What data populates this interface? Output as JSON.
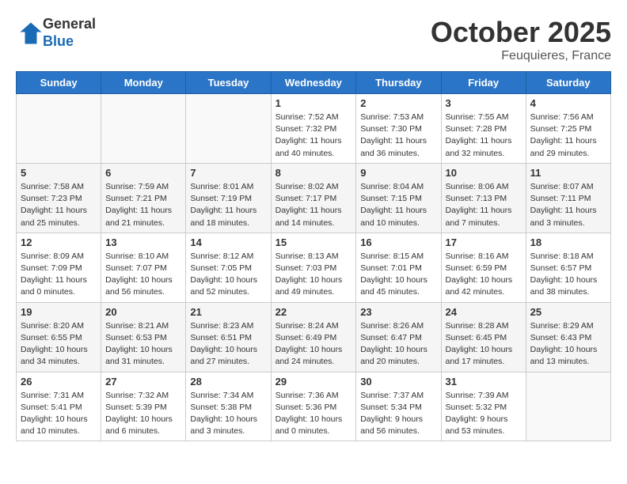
{
  "logo": {
    "line1": "General",
    "line2": "Blue"
  },
  "header": {
    "month": "October 2025",
    "location": "Feuquieres, France"
  },
  "weekdays": [
    "Sunday",
    "Monday",
    "Tuesday",
    "Wednesday",
    "Thursday",
    "Friday",
    "Saturday"
  ],
  "weeks": [
    [
      {
        "day": null,
        "info": null
      },
      {
        "day": null,
        "info": null
      },
      {
        "day": null,
        "info": null
      },
      {
        "day": "1",
        "sunrise": "Sunrise: 7:52 AM",
        "sunset": "Sunset: 7:32 PM",
        "daylight": "Daylight: 11 hours and 40 minutes."
      },
      {
        "day": "2",
        "sunrise": "Sunrise: 7:53 AM",
        "sunset": "Sunset: 7:30 PM",
        "daylight": "Daylight: 11 hours and 36 minutes."
      },
      {
        "day": "3",
        "sunrise": "Sunrise: 7:55 AM",
        "sunset": "Sunset: 7:28 PM",
        "daylight": "Daylight: 11 hours and 32 minutes."
      },
      {
        "day": "4",
        "sunrise": "Sunrise: 7:56 AM",
        "sunset": "Sunset: 7:25 PM",
        "daylight": "Daylight: 11 hours and 29 minutes."
      }
    ],
    [
      {
        "day": "5",
        "sunrise": "Sunrise: 7:58 AM",
        "sunset": "Sunset: 7:23 PM",
        "daylight": "Daylight: 11 hours and 25 minutes."
      },
      {
        "day": "6",
        "sunrise": "Sunrise: 7:59 AM",
        "sunset": "Sunset: 7:21 PM",
        "daylight": "Daylight: 11 hours and 21 minutes."
      },
      {
        "day": "7",
        "sunrise": "Sunrise: 8:01 AM",
        "sunset": "Sunset: 7:19 PM",
        "daylight": "Daylight: 11 hours and 18 minutes."
      },
      {
        "day": "8",
        "sunrise": "Sunrise: 8:02 AM",
        "sunset": "Sunset: 7:17 PM",
        "daylight": "Daylight: 11 hours and 14 minutes."
      },
      {
        "day": "9",
        "sunrise": "Sunrise: 8:04 AM",
        "sunset": "Sunset: 7:15 PM",
        "daylight": "Daylight: 11 hours and 10 minutes."
      },
      {
        "day": "10",
        "sunrise": "Sunrise: 8:06 AM",
        "sunset": "Sunset: 7:13 PM",
        "daylight": "Daylight: 11 hours and 7 minutes."
      },
      {
        "day": "11",
        "sunrise": "Sunrise: 8:07 AM",
        "sunset": "Sunset: 7:11 PM",
        "daylight": "Daylight: 11 hours and 3 minutes."
      }
    ],
    [
      {
        "day": "12",
        "sunrise": "Sunrise: 8:09 AM",
        "sunset": "Sunset: 7:09 PM",
        "daylight": "Daylight: 11 hours and 0 minutes."
      },
      {
        "day": "13",
        "sunrise": "Sunrise: 8:10 AM",
        "sunset": "Sunset: 7:07 PM",
        "daylight": "Daylight: 10 hours and 56 minutes."
      },
      {
        "day": "14",
        "sunrise": "Sunrise: 8:12 AM",
        "sunset": "Sunset: 7:05 PM",
        "daylight": "Daylight: 10 hours and 52 minutes."
      },
      {
        "day": "15",
        "sunrise": "Sunrise: 8:13 AM",
        "sunset": "Sunset: 7:03 PM",
        "daylight": "Daylight: 10 hours and 49 minutes."
      },
      {
        "day": "16",
        "sunrise": "Sunrise: 8:15 AM",
        "sunset": "Sunset: 7:01 PM",
        "daylight": "Daylight: 10 hours and 45 minutes."
      },
      {
        "day": "17",
        "sunrise": "Sunrise: 8:16 AM",
        "sunset": "Sunset: 6:59 PM",
        "daylight": "Daylight: 10 hours and 42 minutes."
      },
      {
        "day": "18",
        "sunrise": "Sunrise: 8:18 AM",
        "sunset": "Sunset: 6:57 PM",
        "daylight": "Daylight: 10 hours and 38 minutes."
      }
    ],
    [
      {
        "day": "19",
        "sunrise": "Sunrise: 8:20 AM",
        "sunset": "Sunset: 6:55 PM",
        "daylight": "Daylight: 10 hours and 34 minutes."
      },
      {
        "day": "20",
        "sunrise": "Sunrise: 8:21 AM",
        "sunset": "Sunset: 6:53 PM",
        "daylight": "Daylight: 10 hours and 31 minutes."
      },
      {
        "day": "21",
        "sunrise": "Sunrise: 8:23 AM",
        "sunset": "Sunset: 6:51 PM",
        "daylight": "Daylight: 10 hours and 27 minutes."
      },
      {
        "day": "22",
        "sunrise": "Sunrise: 8:24 AM",
        "sunset": "Sunset: 6:49 PM",
        "daylight": "Daylight: 10 hours and 24 minutes."
      },
      {
        "day": "23",
        "sunrise": "Sunrise: 8:26 AM",
        "sunset": "Sunset: 6:47 PM",
        "daylight": "Daylight: 10 hours and 20 minutes."
      },
      {
        "day": "24",
        "sunrise": "Sunrise: 8:28 AM",
        "sunset": "Sunset: 6:45 PM",
        "daylight": "Daylight: 10 hours and 17 minutes."
      },
      {
        "day": "25",
        "sunrise": "Sunrise: 8:29 AM",
        "sunset": "Sunset: 6:43 PM",
        "daylight": "Daylight: 10 hours and 13 minutes."
      }
    ],
    [
      {
        "day": "26",
        "sunrise": "Sunrise: 7:31 AM",
        "sunset": "Sunset: 5:41 PM",
        "daylight": "Daylight: 10 hours and 10 minutes."
      },
      {
        "day": "27",
        "sunrise": "Sunrise: 7:32 AM",
        "sunset": "Sunset: 5:39 PM",
        "daylight": "Daylight: 10 hours and 6 minutes."
      },
      {
        "day": "28",
        "sunrise": "Sunrise: 7:34 AM",
        "sunset": "Sunset: 5:38 PM",
        "daylight": "Daylight: 10 hours and 3 minutes."
      },
      {
        "day": "29",
        "sunrise": "Sunrise: 7:36 AM",
        "sunset": "Sunset: 5:36 PM",
        "daylight": "Daylight: 10 hours and 0 minutes."
      },
      {
        "day": "30",
        "sunrise": "Sunrise: 7:37 AM",
        "sunset": "Sunset: 5:34 PM",
        "daylight": "Daylight: 9 hours and 56 minutes."
      },
      {
        "day": "31",
        "sunrise": "Sunrise: 7:39 AM",
        "sunset": "Sunset: 5:32 PM",
        "daylight": "Daylight: 9 hours and 53 minutes."
      },
      {
        "day": null,
        "info": null
      }
    ]
  ]
}
